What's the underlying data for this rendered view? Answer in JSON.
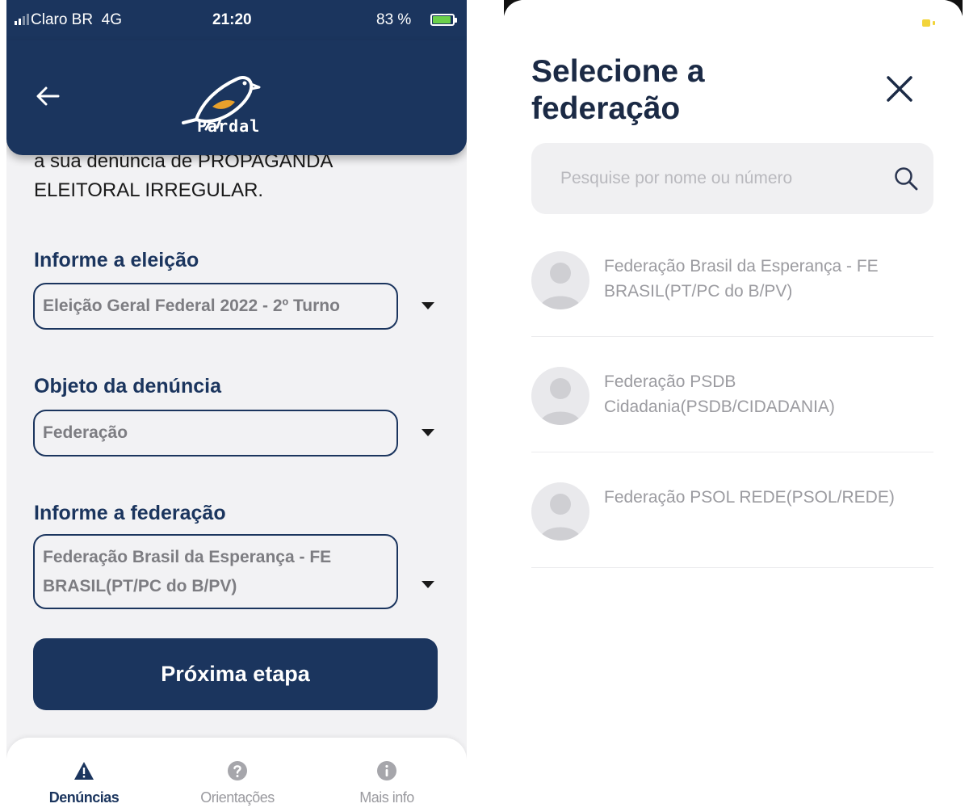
{
  "left_screen": {
    "status_bar": {
      "carrier": "Claro BR",
      "network": "4G",
      "time": "21:20",
      "battery_percent": "83 %"
    },
    "header": {
      "logo_text": "Pardal"
    },
    "intro_text_partial": "a sua denúncia de PROPAGANDA ELEITORAL IRREGULAR.",
    "fields": [
      {
        "label": "Informe a eleição",
        "value": "Eleição Geral Federal 2022 - 2º Turno"
      },
      {
        "label": "Objeto da denúncia",
        "value": "Federação"
      },
      {
        "label": "Informe a federação",
        "value": "Federação Brasil da Esperança - FE BRASIL(PT/PC do B/PV)"
      }
    ],
    "next_button": "Próxima etapa",
    "bottom_nav": [
      {
        "label": "Denúncias",
        "icon": "warning-icon",
        "active": true
      },
      {
        "label": "Orientações",
        "icon": "question-icon",
        "active": false
      },
      {
        "label": "Mais info",
        "icon": "info-icon",
        "active": false
      }
    ]
  },
  "right_screen": {
    "title": "Selecione a federação",
    "search": {
      "placeholder": "Pesquise por nome ou número"
    },
    "federations": [
      {
        "name": "Federação Brasil da Esperança - FE BRASIL(PT/PC do B/PV)"
      },
      {
        "name": "Federação PSDB Cidadania(PSDB/CIDADANIA)"
      },
      {
        "name": "Federação PSOL REDE(PSOL/REDE)"
      }
    ]
  },
  "colors": {
    "primary_navy": "#1b355e",
    "background_light": "#f2f2f4",
    "muted_text": "#9b9ba0",
    "battery_green": "#6bd04a"
  }
}
